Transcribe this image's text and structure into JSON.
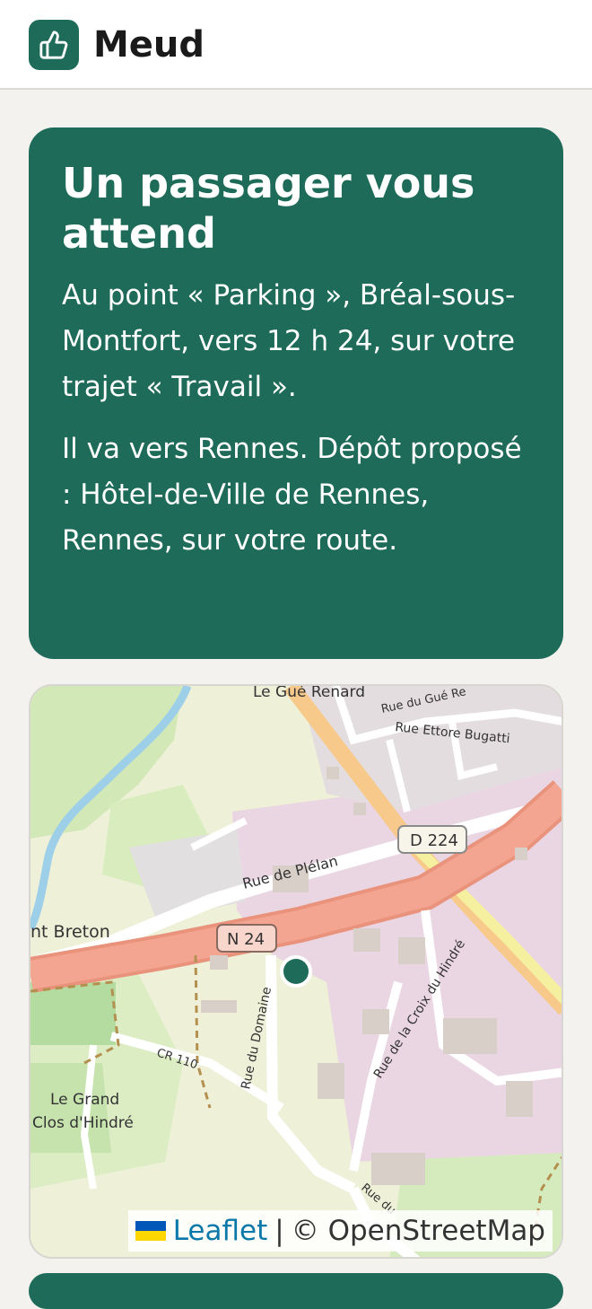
{
  "header": {
    "app_name": "Meud",
    "logo_icon": "thumbs-up-icon"
  },
  "notification": {
    "title": "Un passager vous attend",
    "details": "Au point « Parking », Bréal-sous-Montfort, vers 12 h 24, sur votre trajet « Travail ».",
    "destination": "Il va vers Rennes. Dépôt proposé : Hôtel-de-Ville de Rennes, Rennes, sur votre route."
  },
  "map": {
    "labels": {
      "gue_renard": "Le Gué Renard",
      "rue_gue": "Rue du Gué Re",
      "rue_ettore": "Rue Ettore Bugatti",
      "d224": "D 224",
      "rue_plelan": "Rue de Plélan",
      "breton": "nt Breton",
      "n24": "N 24",
      "rue_domaine": "Rue du Domaine",
      "rue_croix": "Rue de la Croix du Hindré",
      "cr110": "CR 110",
      "le_grand": "Le Grand",
      "clos": "Clos d'Hindré",
      "rue_du": "Rue du"
    },
    "attribution": {
      "leaflet": "Leaflet",
      "separator": "|",
      "osm": "© OpenStreetMap"
    },
    "marker_color": "#1f6b5a"
  },
  "colors": {
    "brand": "#1f6b5a",
    "background": "#f3f2ee"
  }
}
